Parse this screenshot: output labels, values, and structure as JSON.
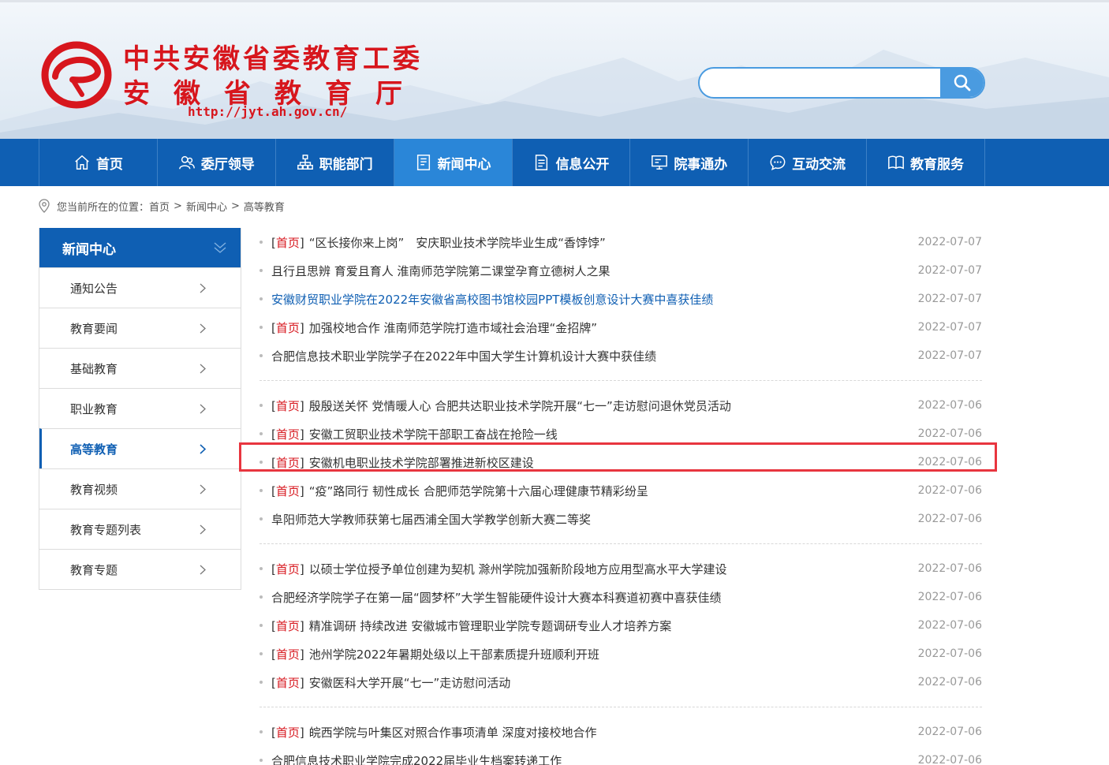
{
  "header": {
    "logo_line1": "中共安徽省委教育工委",
    "logo_line2": "安徽省教育厅",
    "logo_url": "http://jyt.ah.gov.cn/",
    "brand_color": "#d7161d",
    "search": {
      "placeholder": "",
      "value": "",
      "icon": "search-icon"
    }
  },
  "nav": {
    "bg_color": "#0f5fb3",
    "active_color": "#2a86d8",
    "items": [
      {
        "label": "首页",
        "icon": "home-icon"
      },
      {
        "label": "委厅领导",
        "icon": "leaders-icon"
      },
      {
        "label": "职能部门",
        "icon": "org-chart-icon"
      },
      {
        "label": "新闻中心",
        "icon": "news-icon",
        "active": true
      },
      {
        "label": "信息公开",
        "icon": "document-icon"
      },
      {
        "label": "院事通办",
        "icon": "monitor-icon"
      },
      {
        "label": "互动交流",
        "icon": "chat-icon"
      },
      {
        "label": "教育服务",
        "icon": "book-icon"
      }
    ]
  },
  "breadcrumb": {
    "prefix": "您当前所在的位置：",
    "items": [
      "首页",
      "新闻中心",
      "高等教育"
    ],
    "separator": ">"
  },
  "sidebar": {
    "title": "新闻中心",
    "items": [
      {
        "label": "通知公告"
      },
      {
        "label": "教育要闻"
      },
      {
        "label": "基础教育"
      },
      {
        "label": "职业教育"
      },
      {
        "label": "高等教育",
        "active": true
      },
      {
        "label": "教育视频"
      },
      {
        "label": "教育专题列表"
      },
      {
        "label": "教育专题"
      }
    ]
  },
  "news": {
    "tag_word": "首页",
    "groups": [
      [
        {
          "tagged": true,
          "title": "“区长接你来上岗”　安庆职业技术学院毕业生成“香饽饽”",
          "date": "2022-07-07"
        },
        {
          "tagged": false,
          "title": "且行且思辨 育爱且育人 淮南师范学院第二课堂孕育立德树人之果",
          "date": "2022-07-07"
        },
        {
          "tagged": false,
          "blue": true,
          "title": "安徽财贸职业学院在2022年安徽省高校图书馆校园PPT模板创意设计大赛中喜获佳绩",
          "date": "2022-07-07"
        },
        {
          "tagged": true,
          "title": "加强校地合作 淮南师范学院打造市域社会治理“金招牌”",
          "date": "2022-07-07"
        },
        {
          "tagged": false,
          "title": "合肥信息技术职业学院学子在2022年中国大学生计算机设计大赛中获佳绩",
          "date": "2022-07-07"
        }
      ],
      [
        {
          "tagged": true,
          "title": "殷殷送关怀 党情暖人心 合肥共达职业技术学院开展“七一”走访慰问退休党员活动",
          "date": "2022-07-06"
        },
        {
          "tagged": true,
          "title": "安徽工贸职业技术学院干部职工奋战在抢险一线",
          "date": "2022-07-06"
        },
        {
          "tagged": true,
          "title": "安徽机电职业技术学院部署推进新校区建设",
          "date": "2022-07-06"
        },
        {
          "tagged": true,
          "title": "“疫”路同行 韧性成长 合肥师范学院第十六届心理健康节精彩纷呈",
          "date": "2022-07-06"
        },
        {
          "tagged": false,
          "title": "阜阳师范大学教师获第七届西浦全国大学教学创新大赛二等奖",
          "date": "2022-07-06"
        }
      ],
      [
        {
          "tagged": true,
          "title": "以硕士学位授予单位创建为契机 滁州学院加强新阶段地方应用型高水平大学建设",
          "date": "2022-07-06"
        },
        {
          "tagged": false,
          "title": "合肥经济学院学子在第一届“圆梦杯”大学生智能硬件设计大赛本科赛道初赛中喜获佳绩",
          "date": "2022-07-06"
        },
        {
          "tagged": true,
          "title": "精准调研 持续改进 安徽城市管理职业学院专题调研专业人才培养方案",
          "date": "2022-07-06"
        },
        {
          "tagged": true,
          "title": "池州学院2022年暑期处级以上干部素质提升班顺利开班",
          "date": "2022-07-06"
        },
        {
          "tagged": true,
          "title": "安徽医科大学开展“七一”走访慰问活动",
          "date": "2022-07-06"
        }
      ],
      [
        {
          "tagged": true,
          "title": "皖西学院与叶集区对照合作事项清单 深度对接校地合作",
          "date": "2022-07-06"
        },
        {
          "tagged": false,
          "title": "合肥信息技术职业学院完成2022届毕业生档案转递工作",
          "date": "2022-07-06"
        }
      ]
    ]
  }
}
